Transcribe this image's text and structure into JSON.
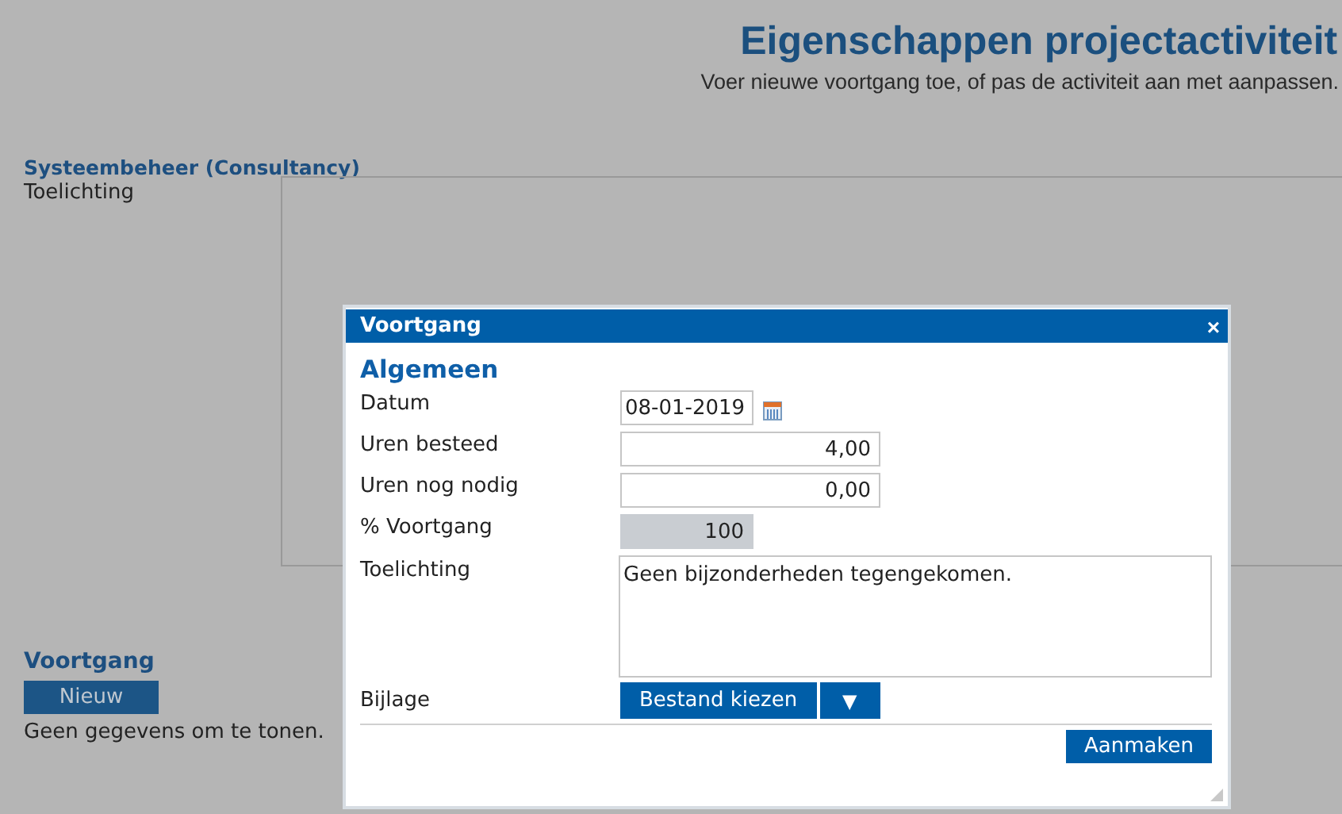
{
  "page": {
    "title": "Eigenschappen projectactiviteit",
    "subtitle": "Voer nieuwe voortgang toe, of pas de activiteit aan met aanpassen."
  },
  "activity": {
    "heading": "Systeembeheer (Consultancy)",
    "label": "Toelichting"
  },
  "progress_section": {
    "heading": "Voortgang",
    "new_button": "Nieuw",
    "empty_text": "Geen gegevens om te tonen."
  },
  "dialog": {
    "title": "Voortgang",
    "close": "×",
    "section": "Algemeen",
    "fields": [
      {
        "kind": "date",
        "label": "Datum",
        "value": "08-01-2019",
        "disabled": false
      },
      {
        "kind": "number",
        "label": "Uren besteed",
        "value": "4,00",
        "disabled": false
      },
      {
        "kind": "number",
        "label": "Uren nog nodig",
        "value": "0,00",
        "disabled": false
      },
      {
        "kind": "short",
        "label": "% Voortgang",
        "value": "100",
        "disabled": true
      },
      {
        "kind": "textarea",
        "label": "Toelichting",
        "value": "Geen bijzonderheden tegengekomen.",
        "disabled": false
      },
      {
        "kind": "file",
        "label": "Bijlage",
        "button": "Bestand kiezen",
        "menu": "▼"
      }
    ],
    "submit": "Aanmaken"
  }
}
